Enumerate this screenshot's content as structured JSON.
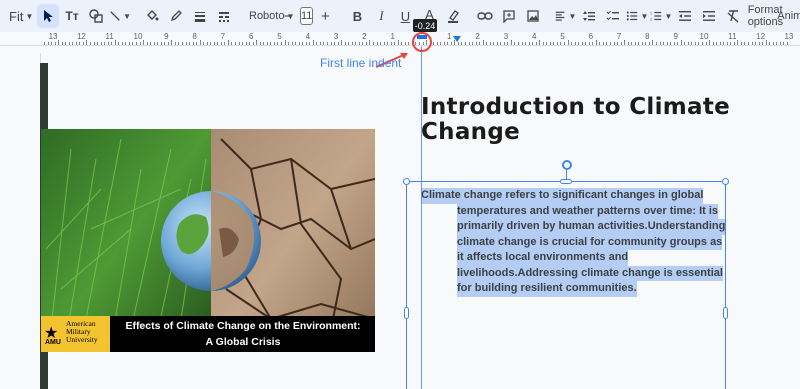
{
  "toolbar": {
    "zoom_label": "Fit",
    "font_name": "Roboto",
    "font_size": "11",
    "bold_label": "B",
    "italic_label": "I",
    "underline_label": "U",
    "text_color_label": "A",
    "textstyle_label": "Tт",
    "format_options_label": "Format options",
    "animate_label": "Animate"
  },
  "ruler": {
    "tooltip": "-0.24",
    "numbers": [
      "13",
      "12",
      "11",
      "10",
      "9",
      "8",
      "7",
      "6",
      "5",
      "4",
      "3",
      "2",
      "1",
      "1",
      "2",
      "3",
      "4",
      "5",
      "6",
      "7",
      "8",
      "9",
      "10",
      "11",
      "12",
      "13"
    ]
  },
  "annotation": {
    "label": "First line indent",
    "color": "#4285f4",
    "circle_color": "#e8453c"
  },
  "slide": {
    "title": "Introduction to Climate Change",
    "body_first_line": "Climate change refers to significant changes in global",
    "body_lines": [
      "temperatures and weather patterns over time: It is",
      "primarily driven by human activities.Understanding",
      "climate change is crucial for community groups as",
      "it affects local environments and",
      "livelihoods.Addressing climate change is essential",
      "for building resilient communities."
    ],
    "image": {
      "caption_line1": "Effects of Climate Change on the Environment:",
      "caption_line2": "A Global Crisis",
      "logo_abbr": "AMU",
      "logo_name_1": "American",
      "logo_name_2": "Military",
      "logo_name_3": "University"
    }
  },
  "colors": {
    "selection": "#b3cdf5",
    "accent": "#1a73e8",
    "logo_yellow": "#f4c430"
  }
}
